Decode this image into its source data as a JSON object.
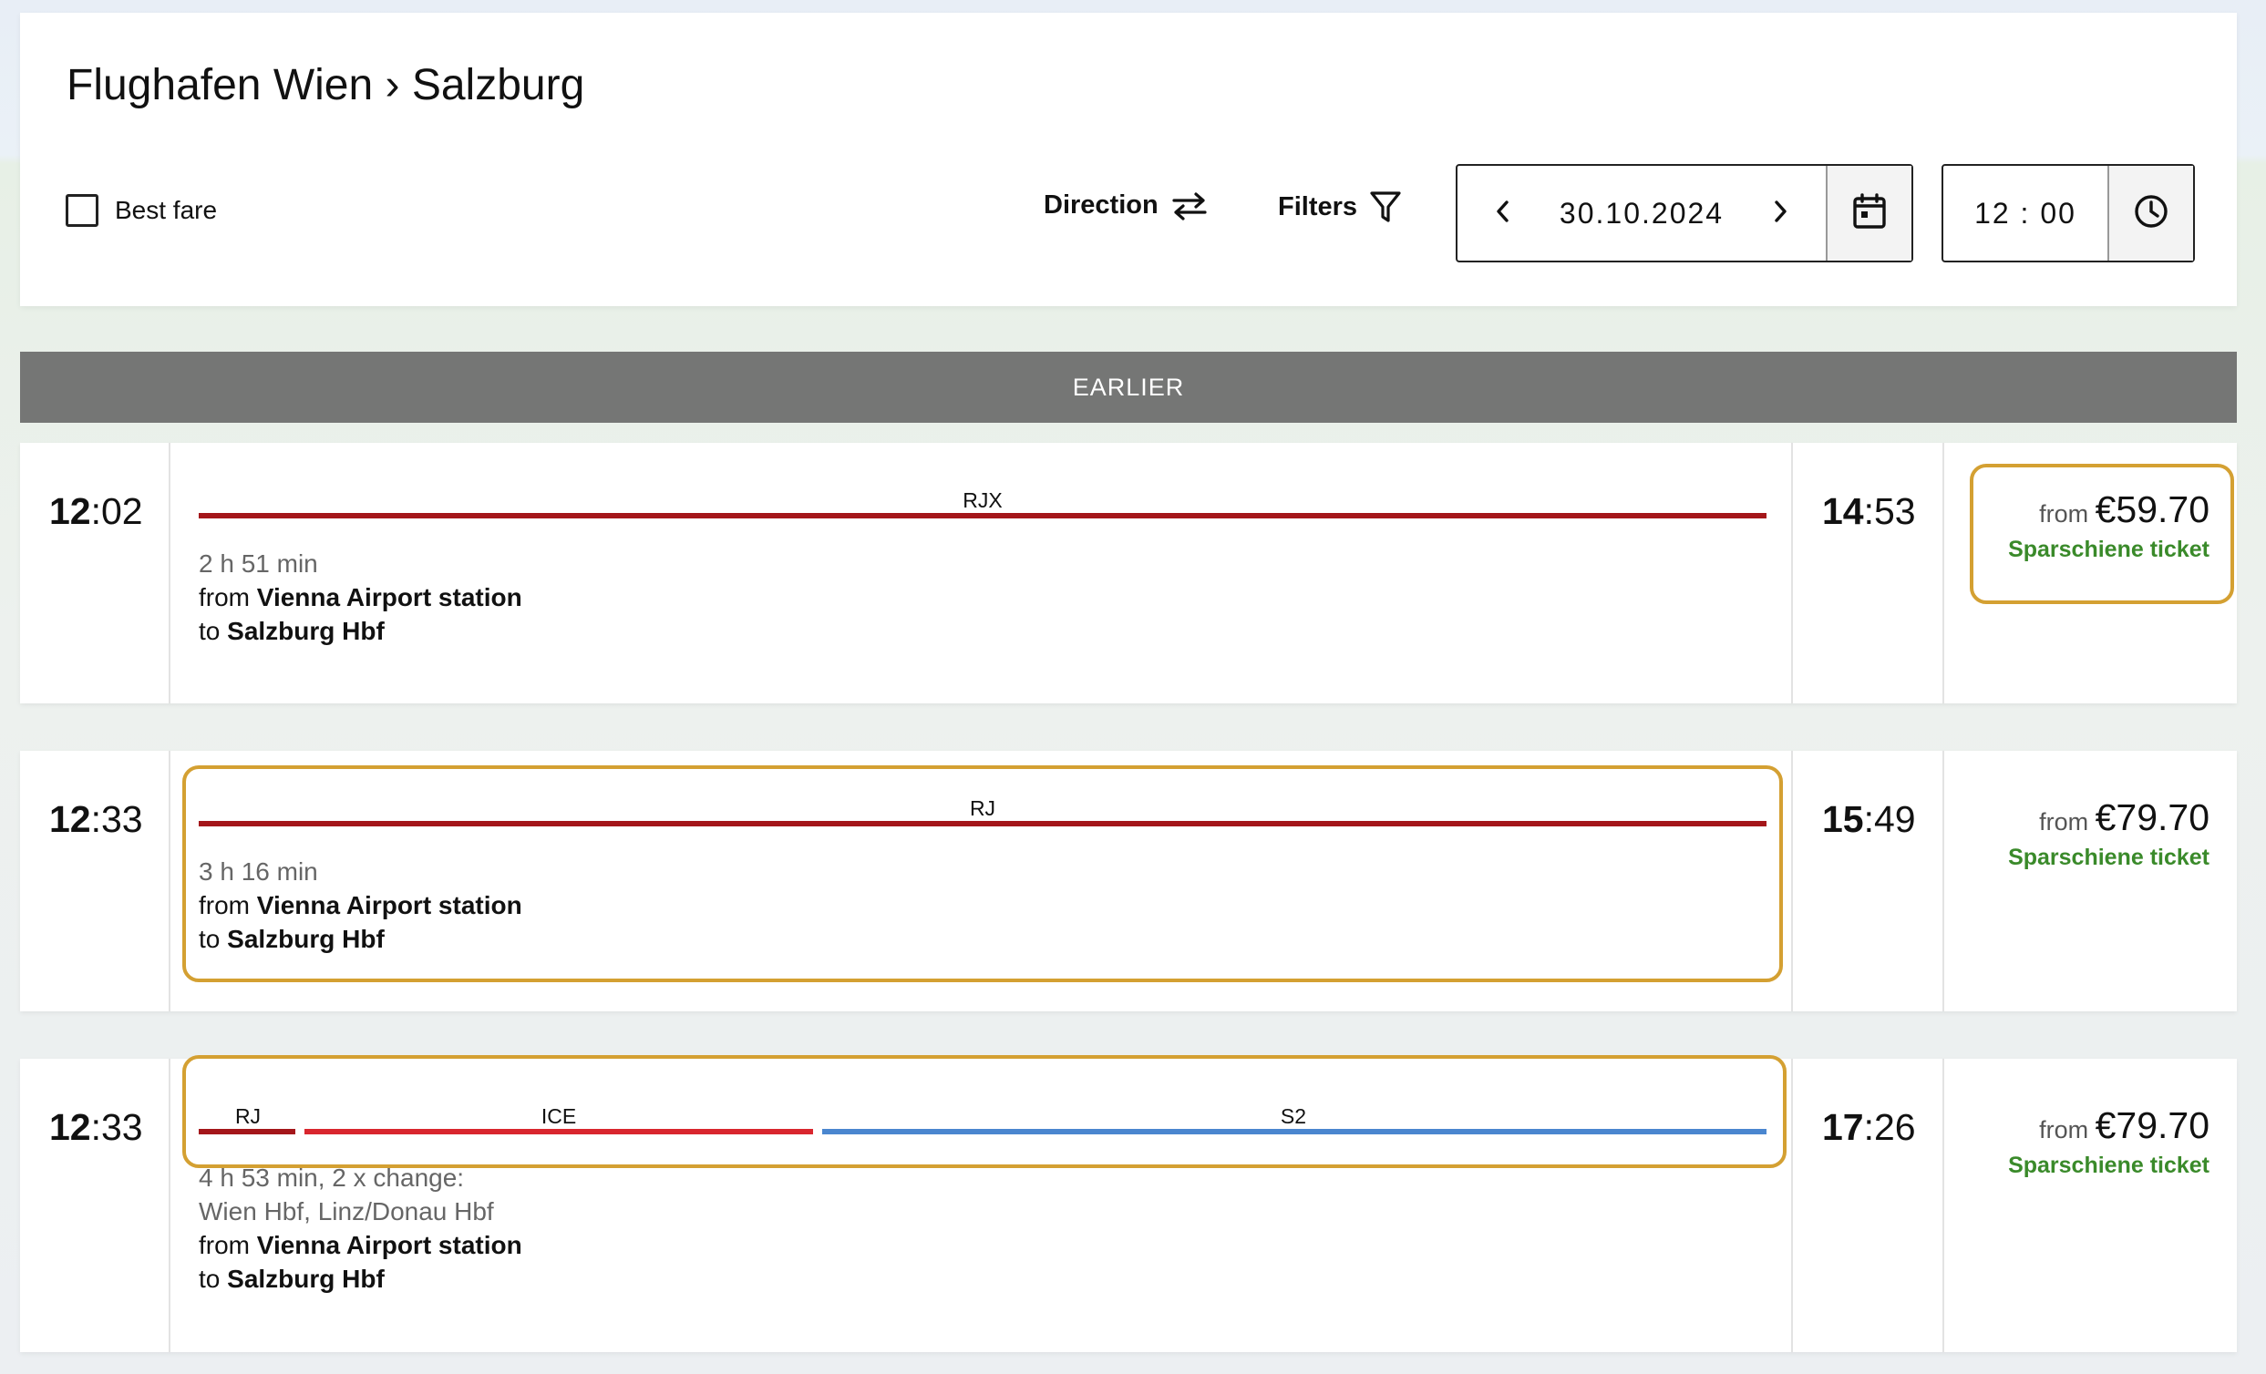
{
  "header": {
    "route_title": "Flughafen Wien › Salzburg",
    "best_fare_label": "Best fare",
    "direction_label": "Direction",
    "filters_label": "Filters",
    "date_value": "30.10.2024",
    "time_value": "12 : 00"
  },
  "earlier_label": "EARLIER",
  "connections": [
    {
      "dep_hour": "12",
      "dep_min": ":02",
      "arr_hour": "14",
      "arr_min": ":53",
      "legs": [
        {
          "label": "RJX",
          "color": "#a4161a"
        }
      ],
      "duration": "2 h 51 min",
      "from_prefix": "from ",
      "from_station": "Vienna Airport station",
      "to_prefix": "to ",
      "to_station": "Salzburg Hbf",
      "price_from": "from ",
      "price": "€59.70",
      "ticket": "Sparschiene ticket"
    },
    {
      "dep_hour": "12",
      "dep_min": ":33",
      "arr_hour": "15",
      "arr_min": ":49",
      "legs": [
        {
          "label": "RJ",
          "color": "#a4161a"
        }
      ],
      "duration": "3 h 16 min",
      "from_prefix": "from ",
      "from_station": "Vienna Airport station",
      "to_prefix": "to ",
      "to_station": "Salzburg Hbf",
      "price_from": "from ",
      "price": "€79.70",
      "ticket": "Sparschiene ticket"
    },
    {
      "dep_hour": "12",
      "dep_min": ":33",
      "arr_hour": "17",
      "arr_min": ":26",
      "legs": [
        {
          "label": "RJ",
          "color": "#a4161a"
        },
        {
          "label": "ICE",
          "color": "#d9262e"
        },
        {
          "label": "S2",
          "color": "#4a86cf"
        }
      ],
      "duration": "4 h 53 min, 2 x change:",
      "changes": "Wien Hbf, Linz/Donau Hbf",
      "from_prefix": "from ",
      "from_station": "Vienna Airport station",
      "to_prefix": "to ",
      "to_station": "Salzburg Hbf",
      "price_from": "from ",
      "price": "€79.70",
      "ticket": "Sparschiene ticket"
    }
  ]
}
